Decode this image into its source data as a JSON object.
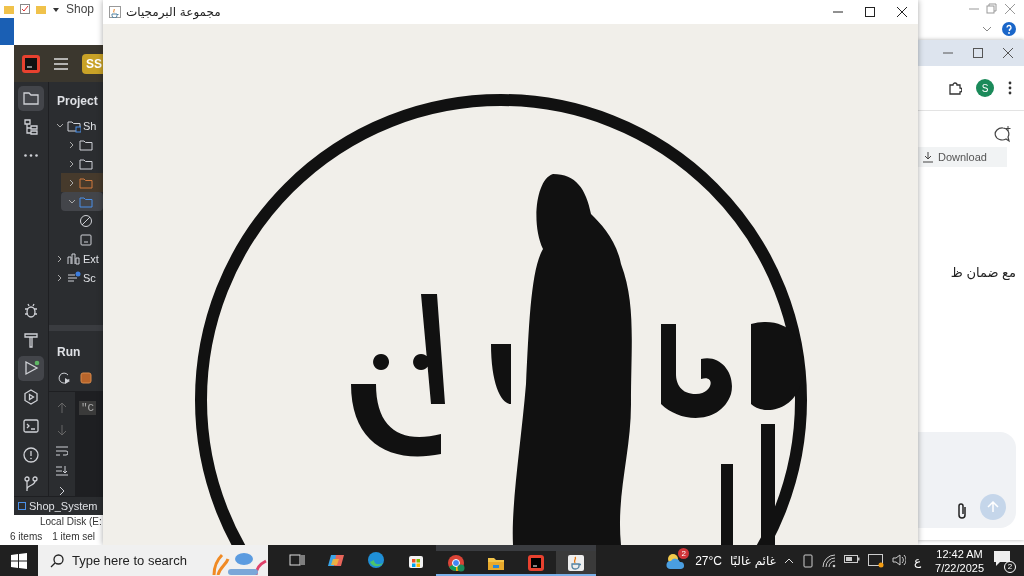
{
  "explorer": {
    "title": "Shop",
    "nav_item": "Local Disk (E:",
    "status_items": "6 items",
    "status_selected": "1 item sel"
  },
  "ide": {
    "project_badge": "SS",
    "tool_stripe": [
      {
        "kind": "project",
        "selected": true
      },
      {
        "kind": "structure",
        "selected": false
      },
      {
        "kind": "more",
        "selected": false
      },
      {
        "kind": "debug",
        "selected": false
      },
      {
        "kind": "build",
        "selected": false
      },
      {
        "kind": "run",
        "selected": true
      },
      {
        "kind": "services",
        "selected": false
      },
      {
        "kind": "terminal",
        "selected": false
      },
      {
        "kind": "problems",
        "selected": false
      },
      {
        "kind": "git",
        "selected": false
      }
    ],
    "project_panel": {
      "title": "Project",
      "tree": [
        {
          "kind": "module",
          "label": "Sh",
          "expanded": true,
          "selected": false,
          "children": [
            {
              "kind": "folder",
              "expanded": false,
              "selected": false
            },
            {
              "kind": "folder",
              "expanded": false,
              "selected": false
            },
            {
              "kind": "excluded-folder",
              "expanded": false,
              "selected": false
            },
            {
              "kind": "source-folder",
              "expanded": true,
              "selected": true,
              "children": [
                {
                  "kind": "blocked",
                  "selected": false
                },
                {
                  "kind": "file",
                  "selected": false
                }
              ]
            }
          ]
        },
        {
          "kind": "library",
          "label": "Ext",
          "expanded": false,
          "selected": false
        },
        {
          "kind": "scratch",
          "label": "Sc",
          "expanded": false,
          "selected": false
        }
      ]
    },
    "run_panel": {
      "title": "Run",
      "console_text": "\"C"
    },
    "status_bar": {
      "project": "Shop_System"
    }
  },
  "browser": {
    "avatar": "S",
    "download_label": "Download",
    "message_text": "مع ضمان ظ"
  },
  "app_window": {
    "title": "مجموعة البرمجيات"
  },
  "taskbar": {
    "search_placeholder": "Type here to search",
    "apps": [
      {
        "kind": "task-view",
        "running": false,
        "active": false
      },
      {
        "kind": "copilot",
        "running": false,
        "active": false
      },
      {
        "kind": "edge",
        "running": false,
        "active": false
      },
      {
        "kind": "store",
        "running": false,
        "active": false
      },
      {
        "kind": "chrome",
        "running": true,
        "active": false
      },
      {
        "kind": "files",
        "running": true,
        "active": false
      },
      {
        "kind": "ide",
        "running": true,
        "active": false
      },
      {
        "kind": "java",
        "running": true,
        "active": true
      }
    ],
    "weather": {
      "badge": "2",
      "temperature": "27°C",
      "condition": "غائم غالبًا"
    },
    "language": "ع",
    "time": "12:42 AM",
    "date": "7/22/2025",
    "notifications": "2"
  }
}
